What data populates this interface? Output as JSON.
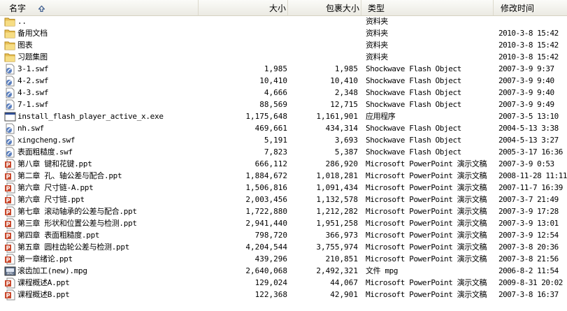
{
  "columns": {
    "name": "名字",
    "size": "大小",
    "packed": "包裹大小",
    "type": "类型",
    "modified": "修改时间"
  },
  "sort_icon": "sort-ascending-icon",
  "colors": {
    "folder": "#f3d36c",
    "swf": "#5a7fbf",
    "ppt": "#c8482c",
    "header_bg": "#ece9d8"
  },
  "rows": [
    {
      "icon": "folder-icon",
      "name": "..",
      "size": "",
      "packed": "",
      "type": "资料夹",
      "modified": ""
    },
    {
      "icon": "folder-icon",
      "name": "备用文档",
      "size": "",
      "packed": "",
      "type": "资料夹",
      "modified": "2010-3-8 15:42"
    },
    {
      "icon": "folder-icon",
      "name": "图表",
      "size": "",
      "packed": "",
      "type": "资料夹",
      "modified": "2010-3-8 15:42"
    },
    {
      "icon": "folder-icon",
      "name": "习题集图",
      "size": "",
      "packed": "",
      "type": "资料夹",
      "modified": "2010-3-8 15:42"
    },
    {
      "icon": "swf-file-icon",
      "name": "3-1.swf",
      "size": "1,985",
      "packed": "1,985",
      "type": "Shockwave Flash Object",
      "modified": "2007-3-9 9:37"
    },
    {
      "icon": "swf-file-icon",
      "name": "4-2.swf",
      "size": "10,410",
      "packed": "10,410",
      "type": "Shockwave Flash Object",
      "modified": "2007-3-9 9:40"
    },
    {
      "icon": "swf-file-icon",
      "name": "4-3.swf",
      "size": "4,666",
      "packed": "2,348",
      "type": "Shockwave Flash Object",
      "modified": "2007-3-9 9:40"
    },
    {
      "icon": "swf-file-icon",
      "name": "7-1.swf",
      "size": "88,569",
      "packed": "12,715",
      "type": "Shockwave Flash Object",
      "modified": "2007-3-9 9:49"
    },
    {
      "icon": "exe-file-icon",
      "name": "install_flash_player_active_x.exe",
      "size": "1,175,648",
      "packed": "1,161,901",
      "type": "应用程序",
      "modified": "2007-3-5 13:10"
    },
    {
      "icon": "swf-file-icon",
      "name": "nh.swf",
      "size": "469,661",
      "packed": "434,314",
      "type": "Shockwave Flash Object",
      "modified": "2004-5-13 3:38"
    },
    {
      "icon": "swf-file-icon",
      "name": "xingcheng.swf",
      "size": "5,191",
      "packed": "3,693",
      "type": "Shockwave Flash Object",
      "modified": "2004-5-13 3:27"
    },
    {
      "icon": "swf-file-icon",
      "name": "表面粗糙度.swf",
      "size": "7,823",
      "packed": "5,387",
      "type": "Shockwave Flash Object",
      "modified": "2005-3-17 16:36"
    },
    {
      "icon": "ppt-file-icon",
      "name": "第八章  键和花键.ppt",
      "size": "666,112",
      "packed": "286,920",
      "type": "Microsoft PowerPoint 演示文稿",
      "modified": "2007-3-9 0:53"
    },
    {
      "icon": "ppt-file-icon",
      "name": "第二章  孔、轴公差与配合.ppt",
      "size": "1,884,672",
      "packed": "1,018,281",
      "type": "Microsoft PowerPoint 演示文稿",
      "modified": "2008-11-28 11:11"
    },
    {
      "icon": "ppt-file-icon",
      "name": "第六章 尺寸链-A.ppt",
      "size": "1,506,816",
      "packed": "1,091,434",
      "type": "Microsoft PowerPoint 演示文稿",
      "modified": "2007-11-7 16:39"
    },
    {
      "icon": "ppt-file-icon",
      "name": "第六章 尺寸链.ppt",
      "size": "2,003,456",
      "packed": "1,132,578",
      "type": "Microsoft PowerPoint 演示文稿",
      "modified": "2007-3-7 21:49"
    },
    {
      "icon": "ppt-file-icon",
      "name": "第七章 滚动轴承的公差与配合.ppt",
      "size": "1,722,880",
      "packed": "1,212,282",
      "type": "Microsoft PowerPoint 演示文稿",
      "modified": "2007-3-9 17:28"
    },
    {
      "icon": "ppt-file-icon",
      "name": "第三章 形状和位置公差与检测.ppt",
      "size": "2,941,440",
      "packed": "1,951,258",
      "type": "Microsoft PowerPoint 演示文稿",
      "modified": "2007-3-9 13:01"
    },
    {
      "icon": "ppt-file-icon",
      "name": "第四章 表面粗糙度.ppt",
      "size": "798,720",
      "packed": "366,973",
      "type": "Microsoft PowerPoint 演示文稿",
      "modified": "2007-3-9 12:54"
    },
    {
      "icon": "ppt-file-icon",
      "name": "第五章 圆柱齿轮公差与检测.ppt",
      "size": "4,204,544",
      "packed": "3,755,974",
      "type": "Microsoft PowerPoint 演示文稿",
      "modified": "2007-3-8 20:36"
    },
    {
      "icon": "ppt-file-icon",
      "name": "第一章绪论.ppt",
      "size": "439,296",
      "packed": "210,851",
      "type": "Microsoft PowerPoint 演示文稿",
      "modified": "2007-3-8 21:56"
    },
    {
      "icon": "mpg-file-icon",
      "name": "滚齿加工(new).mpg",
      "size": "2,640,068",
      "packed": "2,492,321",
      "type": "文件 mpg",
      "modified": "2006-8-2 11:54"
    },
    {
      "icon": "ppt-file-icon",
      "name": "课程概述A.ppt",
      "size": "129,024",
      "packed": "44,067",
      "type": "Microsoft PowerPoint 演示文稿",
      "modified": "2009-8-31 20:02"
    },
    {
      "icon": "ppt-file-icon",
      "name": "课程概述B.ppt",
      "size": "122,368",
      "packed": "42,901",
      "type": "Microsoft PowerPoint 演示文稿",
      "modified": "2007-3-8 16:37"
    }
  ]
}
